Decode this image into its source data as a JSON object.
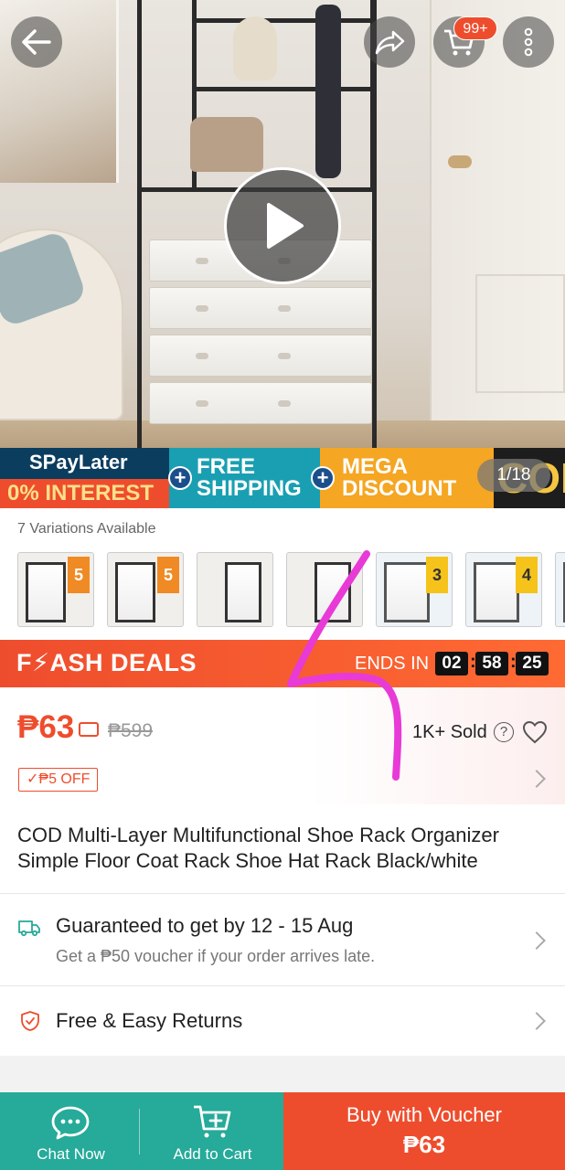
{
  "header": {
    "back_icon": "arrow-left-icon",
    "share_icon": "share-icon",
    "cart_icon": "cart-icon",
    "cart_badge": "99+",
    "more_icon": "more-vertical-icon"
  },
  "media": {
    "play_icon": "play-icon",
    "counter": "1/18"
  },
  "promo_banner": {
    "spaylater": "SPayLater",
    "interest": "0% INTEREST",
    "free_line1": "FREE",
    "free_line2": "SHIPPING",
    "mega_line1": "MEGA",
    "mega_line2": "DISCOUNT",
    "cod": "COD"
  },
  "variations": {
    "label": "7 Variations Available",
    "thumbs": [
      {
        "tag": "5"
      },
      {
        "tag": "5"
      },
      {
        "tag": ""
      },
      {
        "tag": ""
      },
      {
        "tag": "3"
      },
      {
        "tag": "4"
      },
      {
        "tag": ""
      }
    ]
  },
  "flash_deal": {
    "title": "F⚡ASH DEALS",
    "ends_label": "ENDS IN",
    "hours": "02",
    "minutes": "58",
    "seconds": "25"
  },
  "price": {
    "current": "₱63",
    "original": "₱599",
    "sold": "1K+ Sold",
    "voucher": "✓₱5 OFF"
  },
  "product": {
    "title": "COD Multi-Layer Multifunctional Shoe Rack Organizer Simple Floor Coat Rack Shoe Hat Rack Black/white"
  },
  "shipping": {
    "title": "Guaranteed to get by 12 - 15 Aug",
    "sub": "Get a ₱50 voucher if your order arrives late."
  },
  "returns": {
    "title": "Free & Easy Returns"
  },
  "bottom_bar": {
    "chat_label": "Chat Now",
    "cart_label": "Add to Cart",
    "buy_line1": "Buy with Voucher",
    "buy_line2": "₱63"
  },
  "colors": {
    "brand": "#ee4d2d",
    "teal": "#26aa99",
    "annotation": "#e83ad6"
  }
}
